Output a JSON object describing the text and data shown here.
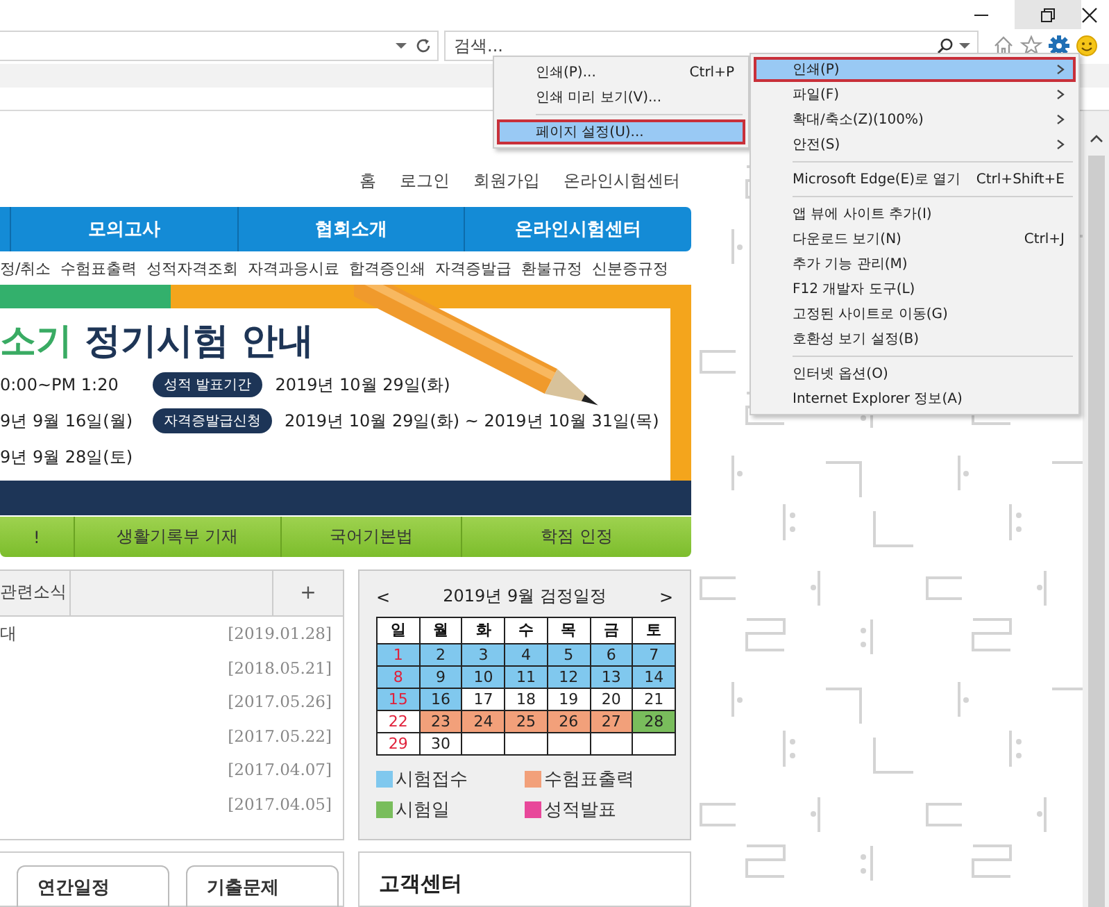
{
  "search": {
    "placeholder": "검색..."
  },
  "page": {
    "top_links": [
      "홈",
      "로그인",
      "회원가입",
      "온라인시험센터"
    ],
    "nav": [
      "모의고사",
      "협회소개",
      "온라인시험센터"
    ],
    "sub_nav": [
      "정/취소",
      "수험표출력",
      "성적자격조회",
      "자격과응시료",
      "합격증인쇄",
      "자격증발급",
      "환불규정",
      "신분증규정"
    ],
    "banner": {
      "title_highlight": "소기",
      "title": "정기시험 안내",
      "left_lines": [
        "0:00~PM 1:20",
        "9년 9월 16일(월)",
        "9년 9월 28일(토)"
      ],
      "schedule": [
        {
          "label": "성적 발표기간",
          "value": "2019년 10월 29일(화)"
        },
        {
          "label": "자격증발급신청",
          "value": "2019년 10월 29일(화) ~ 2019년 10월 31일(목)"
        }
      ]
    },
    "quick_links": [
      "!",
      "생활기록부 기재",
      "국어기본법",
      "학점 인정"
    ],
    "news": {
      "tab": "관련소식",
      "more": "+",
      "items": [
        {
          "title": "대",
          "date": "[2019.01.28]"
        },
        {
          "date": "[2018.05.21]"
        },
        {
          "date": "[2017.05.26]"
        },
        {
          "date": "[2017.05.22]"
        },
        {
          "date": "[2017.04.07]"
        },
        {
          "date": "[2017.04.05]"
        }
      ]
    },
    "calendar": {
      "prev": "<",
      "title": "2019년 9월 검정일정",
      "next": ">",
      "weekdays": [
        "일",
        "월",
        "화",
        "수",
        "목",
        "금",
        "토"
      ],
      "weeks": [
        [
          {
            "day": "1",
            "kind": "apply"
          },
          {
            "day": "2",
            "kind": "apply"
          },
          {
            "day": "3",
            "kind": "apply"
          },
          {
            "day": "4",
            "kind": "apply"
          },
          {
            "day": "5",
            "kind": "apply"
          },
          {
            "day": "6",
            "kind": "apply"
          },
          {
            "day": "7",
            "kind": "apply"
          }
        ],
        [
          {
            "day": "8",
            "kind": "apply"
          },
          {
            "day": "9",
            "kind": "apply"
          },
          {
            "day": "10",
            "kind": "apply"
          },
          {
            "day": "11",
            "kind": "apply"
          },
          {
            "day": "12",
            "kind": "apply"
          },
          {
            "day": "13",
            "kind": "apply"
          },
          {
            "day": "14",
            "kind": "apply"
          }
        ],
        [
          {
            "day": "15",
            "kind": "apply"
          },
          {
            "day": "16",
            "kind": "apply"
          },
          {
            "day": "17",
            "kind": "none"
          },
          {
            "day": "18",
            "kind": "none"
          },
          {
            "day": "19",
            "kind": "none"
          },
          {
            "day": "20",
            "kind": "none"
          },
          {
            "day": "21",
            "kind": "none"
          }
        ],
        [
          {
            "day": "22",
            "kind": "none"
          },
          {
            "day": "23",
            "kind": "print"
          },
          {
            "day": "24",
            "kind": "print"
          },
          {
            "day": "25",
            "kind": "print"
          },
          {
            "day": "26",
            "kind": "print"
          },
          {
            "day": "27",
            "kind": "print"
          },
          {
            "day": "28",
            "kind": "exam"
          }
        ],
        [
          {
            "day": "29",
            "kind": "none"
          },
          {
            "day": "30",
            "kind": "none"
          }
        ]
      ],
      "legend": [
        {
          "label": "시험접수",
          "kind": "apply",
          "color": "#80c8ee"
        },
        {
          "label": "수험표출력",
          "kind": "print",
          "color": "#f2a07a"
        },
        {
          "label": "시험일",
          "kind": "exam",
          "color": "#79bd5c"
        },
        {
          "label": "성적발표",
          "kind": "result",
          "color": "#e8489a"
        }
      ]
    },
    "shortcuts": [
      "연간일정",
      "기출문제"
    ],
    "support": {
      "title": "고객센터"
    }
  },
  "print_menu": {
    "items": [
      {
        "kind": "item",
        "label": "인쇄(P)...",
        "shortcut": "Ctrl+P",
        "selected": false
      },
      {
        "kind": "item",
        "label": "인쇄 미리 보기(V)...",
        "selected": false
      },
      {
        "kind": "separator"
      },
      {
        "kind": "item",
        "label": "페이지 설정(U)...",
        "selected": true
      }
    ]
  },
  "tools_menu": {
    "items": [
      {
        "kind": "item",
        "label": "인쇄(P)",
        "submenu": true,
        "selected": true
      },
      {
        "kind": "item",
        "label": "파일(F)",
        "submenu": true,
        "selected": false
      },
      {
        "kind": "item",
        "label": "확대/축소(Z)(100%)",
        "submenu": true,
        "selected": false
      },
      {
        "kind": "item",
        "label": "안전(S)",
        "submenu": true,
        "selected": false
      },
      {
        "kind": "separator"
      },
      {
        "kind": "item",
        "label": "Microsoft Edge(E)로 열기",
        "shortcut": "Ctrl+Shift+E",
        "selected": false
      },
      {
        "kind": "separator"
      },
      {
        "kind": "item",
        "label": "앱 뷰에 사이트 추가(I)",
        "selected": false
      },
      {
        "kind": "item",
        "label": "다운로드 보기(N)",
        "shortcut": "Ctrl+J",
        "selected": false
      },
      {
        "kind": "item",
        "label": "추가 기능 관리(M)",
        "selected": false
      },
      {
        "kind": "item",
        "label": "F12 개발자 도구(L)",
        "selected": false
      },
      {
        "kind": "item",
        "label": "고정된 사이트로 이동(G)",
        "selected": false
      },
      {
        "kind": "item",
        "label": "호환성 보기 설정(B)",
        "selected": false
      },
      {
        "kind": "separator"
      },
      {
        "kind": "item",
        "label": "인터넷 옵션(O)",
        "selected": false
      },
      {
        "kind": "item",
        "label": "Internet Explorer 정보(A)",
        "selected": false
      }
    ]
  }
}
